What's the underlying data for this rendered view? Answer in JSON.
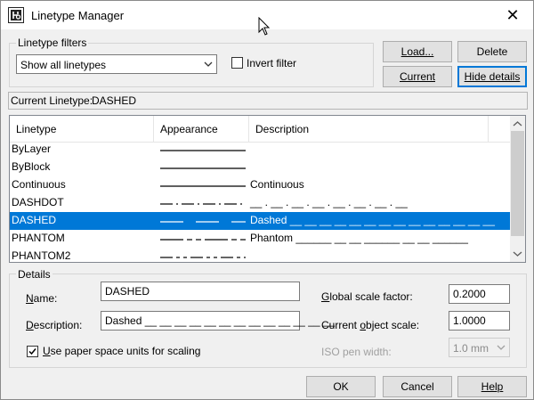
{
  "window": {
    "title": "Linetype Manager"
  },
  "filters": {
    "legend": "Linetype filters",
    "selected": "Show all linetypes",
    "invert_label": "Invert filter",
    "invert_checked": false
  },
  "buttons": {
    "load": "Load...",
    "delete": "Delete",
    "current": "Current",
    "hide_details": "Hide details",
    "ok": "OK",
    "cancel": "Cancel",
    "help": "Help"
  },
  "current_linetype": {
    "label": "Current Linetype:",
    "value": "DASHED"
  },
  "list": {
    "columns": [
      "Linetype",
      "Appearance",
      "Description"
    ],
    "rows": [
      {
        "name": "ByLayer",
        "pattern": "solid",
        "description": "",
        "selected": false
      },
      {
        "name": "ByBlock",
        "pattern": "solid",
        "description": "",
        "selected": false
      },
      {
        "name": "Continuous",
        "pattern": "solid",
        "description": "Continuous",
        "selected": false
      },
      {
        "name": "DASHDOT",
        "pattern": "dashdot",
        "description": "__ . __ . __ . __ . __ . __ . __ . __",
        "selected": false
      },
      {
        "name": "DASHED",
        "pattern": "dashed",
        "description": "Dashed __ __ __ __ __ __ __ __ __ __ __ __ __ __",
        "selected": true
      },
      {
        "name": "PHANTOM",
        "pattern": "phantom",
        "description": "Phantom ______ __ __ ______ __ __ ______",
        "selected": false
      },
      {
        "name": "PHANTOM2",
        "pattern": "phantom2",
        "description": "",
        "selected": false
      }
    ]
  },
  "details": {
    "legend": "Details",
    "name_label": "Name:",
    "name_value": "DASHED",
    "description_label": "Description:",
    "description_value": "Dashed __ __ __ __ __ __ __ __ __ __ __ __ __",
    "paper_space_label": "Use paper space units for scaling",
    "paper_space_checked": true,
    "global_scale_label": "Global scale factor:",
    "global_scale_value": "0.2000",
    "object_scale_label": "Current object scale:",
    "object_scale_value": "1.0000",
    "iso_label": "ISO pen width:",
    "iso_value": "1.0 mm"
  },
  "colors": {
    "selection": "#0078d7",
    "default_button_border": "#0078d7"
  }
}
